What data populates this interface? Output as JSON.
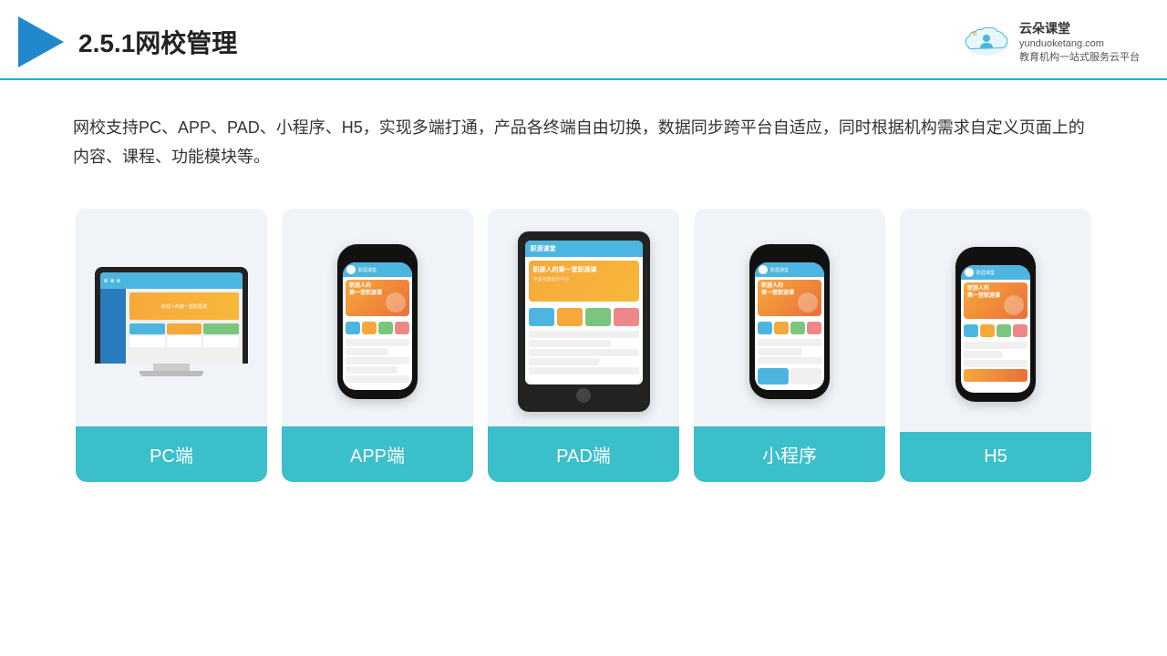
{
  "header": {
    "title": "2.5.1网校管理",
    "logo": {
      "name": "云朵课堂",
      "url": "yunduoketang.com",
      "tagline": "教育机构一站\n式服务云平台"
    }
  },
  "description": "网校支持PC、APP、PAD、小程序、H5，实现多端打通，产品各终端自由切换，数据同步跨平台自适应，同时根据机构需求自定义页面上的内容、课程、功能模块等。",
  "cards": [
    {
      "id": "pc",
      "label": "PC端",
      "type": "pc"
    },
    {
      "id": "app",
      "label": "APP端",
      "type": "phone"
    },
    {
      "id": "pad",
      "label": "PAD端",
      "type": "tablet"
    },
    {
      "id": "miniprogram",
      "label": "小程序",
      "type": "phone"
    },
    {
      "id": "h5",
      "label": "H5",
      "type": "phone"
    }
  ]
}
